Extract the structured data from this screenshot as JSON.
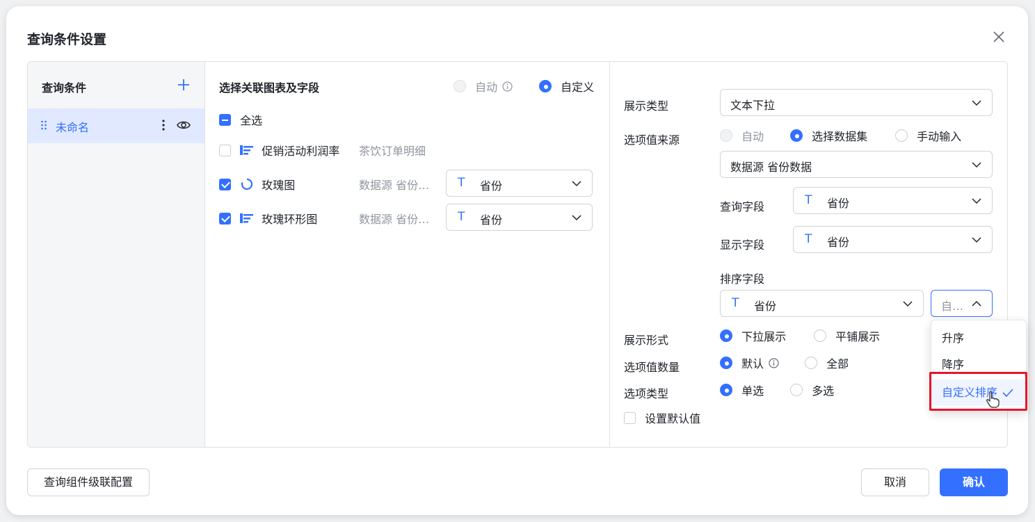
{
  "dialog": {
    "title": "查询条件设置"
  },
  "left": {
    "title": "查询条件",
    "items": [
      {
        "label": "未命名"
      }
    ]
  },
  "middle": {
    "title": "选择关联图表及字段",
    "mode_auto": "自动",
    "mode_custom": "自定义",
    "select_all": "全选",
    "rows": [
      {
        "chart": "促销活动利润率",
        "dataset": "茶饮订单明细",
        "checked": false
      },
      {
        "chart": "玫瑰图",
        "dataset": "数据源 省份…",
        "field": "省份",
        "checked": true
      },
      {
        "chart": "玫瑰环形图",
        "dataset": "数据源 省份…",
        "field": "省份",
        "checked": true
      }
    ]
  },
  "right": {
    "display_type_label": "展示类型",
    "display_type_value": "文本下拉",
    "option_source_label": "选项值来源",
    "source_auto": "自动",
    "source_dataset": "选择数据集",
    "source_manual": "手动输入",
    "dataset_value": "数据源 省份数据",
    "query_field_label": "查询字段",
    "query_field_value": "省份",
    "display_field_label": "显示字段",
    "display_field_value": "省份",
    "sort_field_label": "排序字段",
    "sort_field_value": "省份",
    "sort_order_value": "自…",
    "display_form_label": "展示形式",
    "form_dropdown": "下拉展示",
    "form_tile": "平铺展示",
    "option_count_label": "选项值数量",
    "count_default": "默认",
    "count_all": "全部",
    "option_type_label": "选项类型",
    "type_single": "单选",
    "type_multi": "多选",
    "set_default_label": "设置默认值"
  },
  "sort_dropdown": {
    "options": [
      "升序",
      "降序",
      "自定义排序"
    ],
    "selected": "自定义排序"
  },
  "footer": {
    "cascade_button": "查询组件级联配置",
    "cancel": "取消",
    "confirm": "确认"
  },
  "colors": {
    "accent": "#3370ff",
    "highlight": "#e8142a"
  }
}
